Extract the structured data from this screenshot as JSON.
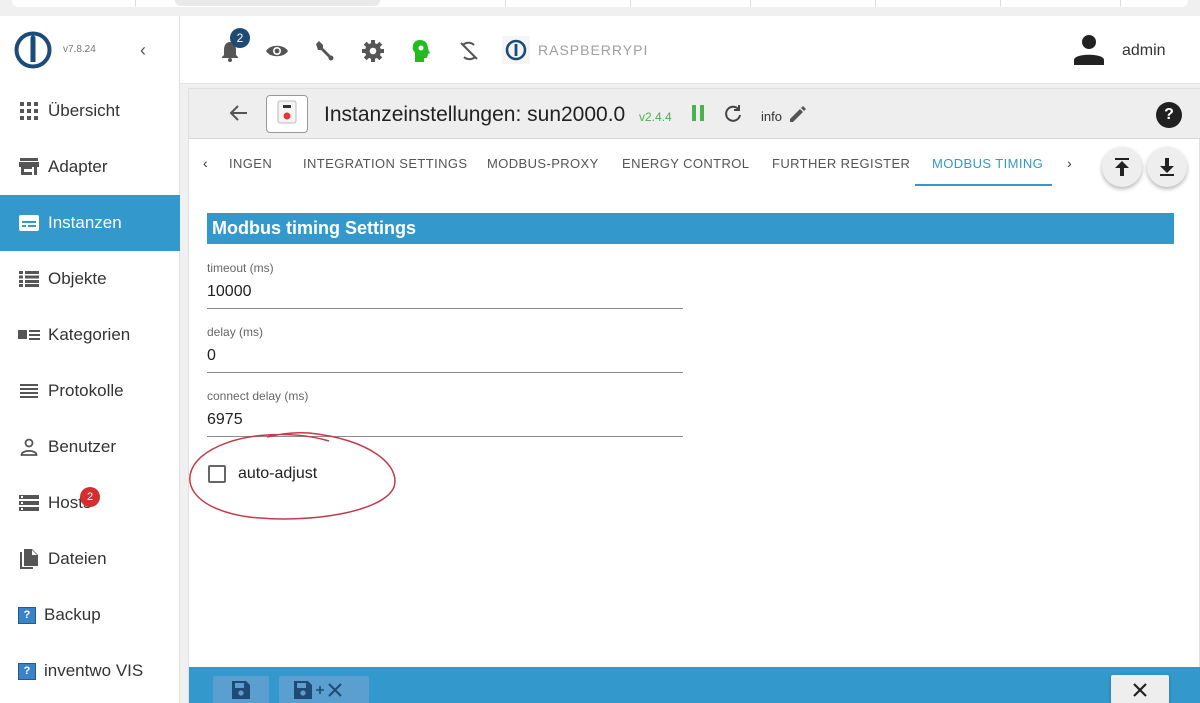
{
  "app": {
    "version": "v7.8.24"
  },
  "sidebar": {
    "items": [
      {
        "label": "Übersicht",
        "icon": "grid-icon"
      },
      {
        "label": "Adapter",
        "icon": "store-icon"
      },
      {
        "label": "Instanzen",
        "icon": "instances-icon",
        "active": true
      },
      {
        "label": "Objekte",
        "icon": "list-icon"
      },
      {
        "label": "Kategorien",
        "icon": "categories-icon"
      },
      {
        "label": "Protokolle",
        "icon": "logs-icon"
      },
      {
        "label": "Benutzer",
        "icon": "user-icon"
      },
      {
        "label": "Hosts",
        "icon": "hosts-icon",
        "badge": "2"
      },
      {
        "label": "Dateien",
        "icon": "files-icon"
      },
      {
        "label": "Backup",
        "icon": "question-box-icon"
      },
      {
        "label": "inventwo VIS",
        "icon": "question-box-icon"
      }
    ]
  },
  "topbar": {
    "notifications_count": "2",
    "hostname": "RASPBERRYPI",
    "user": "admin"
  },
  "instance": {
    "title": "Instanzeinstellungen: sun2000.0",
    "version": "v2.4.4",
    "info_label": "info"
  },
  "tabs": {
    "items": [
      "INGEN",
      "INTEGRATION SETTINGS",
      "MODBUS-PROXY",
      "ENERGY CONTROL",
      "FURTHER REGISTER",
      "MODBUS TIMING"
    ],
    "active_index": 5
  },
  "section": {
    "title": "Modbus timing Settings"
  },
  "fields": [
    {
      "label": "timeout (ms)",
      "value": "10000"
    },
    {
      "label": "delay (ms)",
      "value": "0"
    },
    {
      "label": "connect delay (ms)",
      "value": "6975"
    }
  ],
  "checkbox": {
    "label": "auto-adjust",
    "checked": false
  },
  "colors": {
    "accent": "#3399cc",
    "badge": "#d32f2f",
    "version_green": "#4caf50"
  }
}
